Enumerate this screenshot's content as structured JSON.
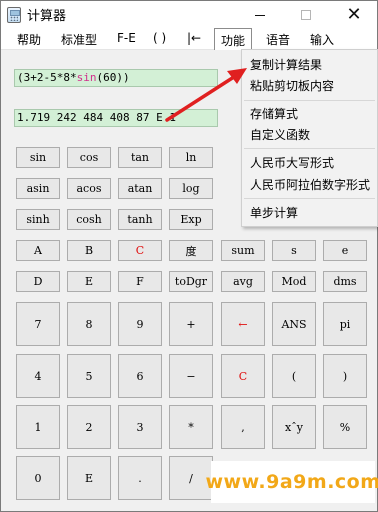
{
  "window": {
    "title": "计算器"
  },
  "menubar": {
    "items": [
      {
        "label": "帮助"
      },
      {
        "label": "标准型"
      },
      {
        "label": "F-E"
      },
      {
        "label": "( )"
      },
      {
        "label": "|←"
      },
      {
        "label": "功能"
      },
      {
        "label": "语音"
      },
      {
        "label": "输入"
      }
    ],
    "active": "功能"
  },
  "display": {
    "expression_prefix": "(3+2-5*8*",
    "expression_fn": "sin",
    "expression_suffix": "(60))",
    "result": "1.719 242 484 408 87 E 1"
  },
  "keypad": {
    "rows": [
      [
        "sin",
        "cos",
        "tan",
        "ln"
      ],
      [
        "asin",
        "acos",
        "atan",
        "log"
      ],
      [
        "sinh",
        "cosh",
        "tanh",
        "Exp"
      ],
      [
        "A",
        "B",
        "C",
        "度",
        "sum",
        "s",
        "e"
      ],
      [
        "D",
        "E",
        "F",
        "toDgr",
        "avg",
        "Mod",
        "dms"
      ],
      [
        "7",
        "8",
        "9",
        "+",
        "←",
        "ANS",
        "pi"
      ],
      [
        "4",
        "5",
        "6",
        "−",
        "C",
        "(",
        ")"
      ],
      [
        "1",
        "2",
        "3",
        "*",
        ",",
        "xˆy",
        "%"
      ],
      [
        "0",
        "E",
        ".",
        "/"
      ]
    ],
    "red_keys": [
      "←",
      "C"
    ]
  },
  "function_menu": {
    "groups": [
      [
        "复制计算结果",
        "粘贴剪切板内容"
      ],
      [
        "存储算式",
        "自定义函数"
      ],
      [
        "人民币大写形式",
        "人民币阿拉伯数字形式"
      ],
      [
        "单步计算"
      ]
    ]
  },
  "watermark": {
    "text": "www.9a9m.com"
  },
  "colors": {
    "display_bg": "#d3f0d6",
    "function_name": "#d0308c",
    "red_key": "#e01010",
    "arrow": "#e02020",
    "watermark": "#f2a818"
  }
}
